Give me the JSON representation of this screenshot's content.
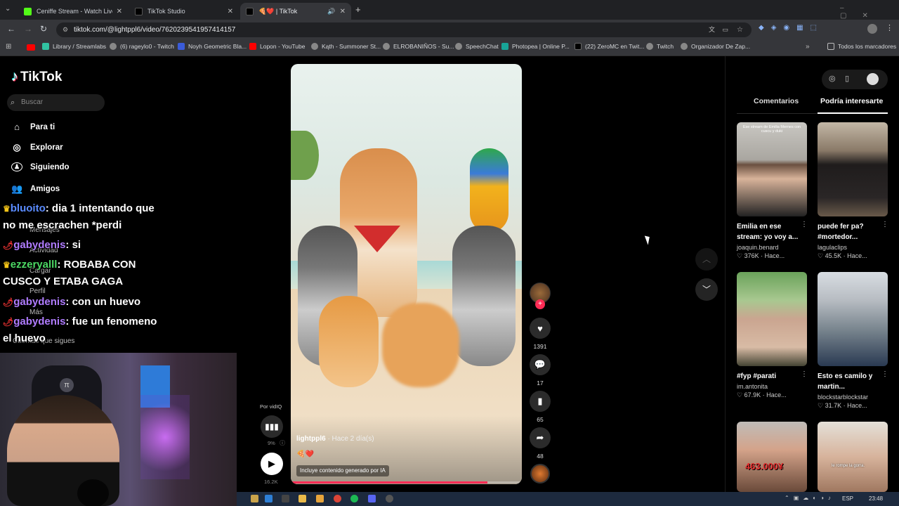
{
  "browser": {
    "tabs": [
      {
        "title": "Ceniffe Stream - Watch Live on"
      },
      {
        "title": "TikTok Studio"
      },
      {
        "title": "🍕❤️ | TikTok"
      }
    ],
    "url": "tiktok.com/@lightppl6/video/7620239541957414157",
    "bookmarks": [
      "Library / Streamlabs",
      "(6) rageylo0 - Twitch",
      "Noyh Geometric Bla...",
      "Lopon - YouTube",
      "Kąth - Summoner St...",
      "ELROBANIÑOS - Su...",
      "SpeechChat",
      "Photopea | Online P...",
      "(22) ZeroMC en Twit...",
      "Twitch",
      "Organizador De Zap..."
    ],
    "all_bookmarks": "Todos los marcadores"
  },
  "tiktok": {
    "logo": "TikTok",
    "search_placeholder": "Buscar",
    "nav": [
      {
        "label": "Para ti",
        "icon": "home-icon"
      },
      {
        "label": "Explorar",
        "icon": "compass-icon"
      },
      {
        "label": "Siguiendo",
        "icon": "following-icon"
      },
      {
        "label": "Amigos",
        "icon": "friends-icon"
      }
    ],
    "nav_hidden": [
      "Mensajes",
      "Actividad",
      "Cargar",
      "Perfil",
      "Más"
    ],
    "following_label": "Cuentas que sigues"
  },
  "chat": [
    {
      "user": "bluoito",
      "message": ": dia 1 intentando que"
    },
    {
      "user": "",
      "message": "no me escrachen *perdi"
    },
    {
      "user": "gabydenis",
      "message": ": si"
    },
    {
      "user": "ezzeryalll",
      "message": ": ROBABA CON"
    },
    {
      "user": "",
      "message": "CUSCO Y ETABA GAGA"
    },
    {
      "user": "gabydenis",
      "message": ": con un huevo"
    },
    {
      "user": "gabydenis",
      "message": ": fue un fenomeno"
    },
    {
      "user": "",
      "message": "el huevo"
    }
  ],
  "video": {
    "author": "lightppl6",
    "time_ago": "· Hace 2 día(s)",
    "caption": "🍕❤️",
    "ai_label": "Incluye contenido generado por IA",
    "progress_pct": 85
  },
  "vidiq": {
    "label": "Por vidIQ",
    "pct": "9%",
    "views": "16.2K"
  },
  "actions": {
    "likes": "1391",
    "comments": "17",
    "saves": "65",
    "shares": "48"
  },
  "right_panel": {
    "tabs": [
      "Comentarios",
      "Podría interesarte"
    ],
    "cards": [
      {
        "title": "Emilia en ese stream: yo voy a...",
        "author": "joaquin.benard",
        "likes": "376K",
        "time": "· Hace...",
        "overlay": "Ese stream de Emilia Mernes con cuscu y duki"
      },
      {
        "title": "puede fer pa? #mortedor...",
        "author": "lagulaclips",
        "likes": "45.5K",
        "time": "· Hace...",
        "overlay": ""
      },
      {
        "title": "#fyp #parati",
        "author": "im.antonita",
        "likes": "67.9K",
        "time": "· Hace...",
        "overlay": ""
      },
      {
        "title": "Esto es camilo y martin...",
        "author": "blockstarblockstar",
        "likes": "31.7K",
        "time": "· Hace...",
        "overlay": ""
      },
      {
        "title": "",
        "author": "",
        "likes": "",
        "time": "",
        "overlay": "463.000¥"
      },
      {
        "title": "",
        "author": "",
        "likes": "",
        "time": "",
        "overlay": "le rompe la gorra."
      }
    ]
  },
  "taskbar": {
    "lang": "ESP",
    "time": "23:48"
  }
}
